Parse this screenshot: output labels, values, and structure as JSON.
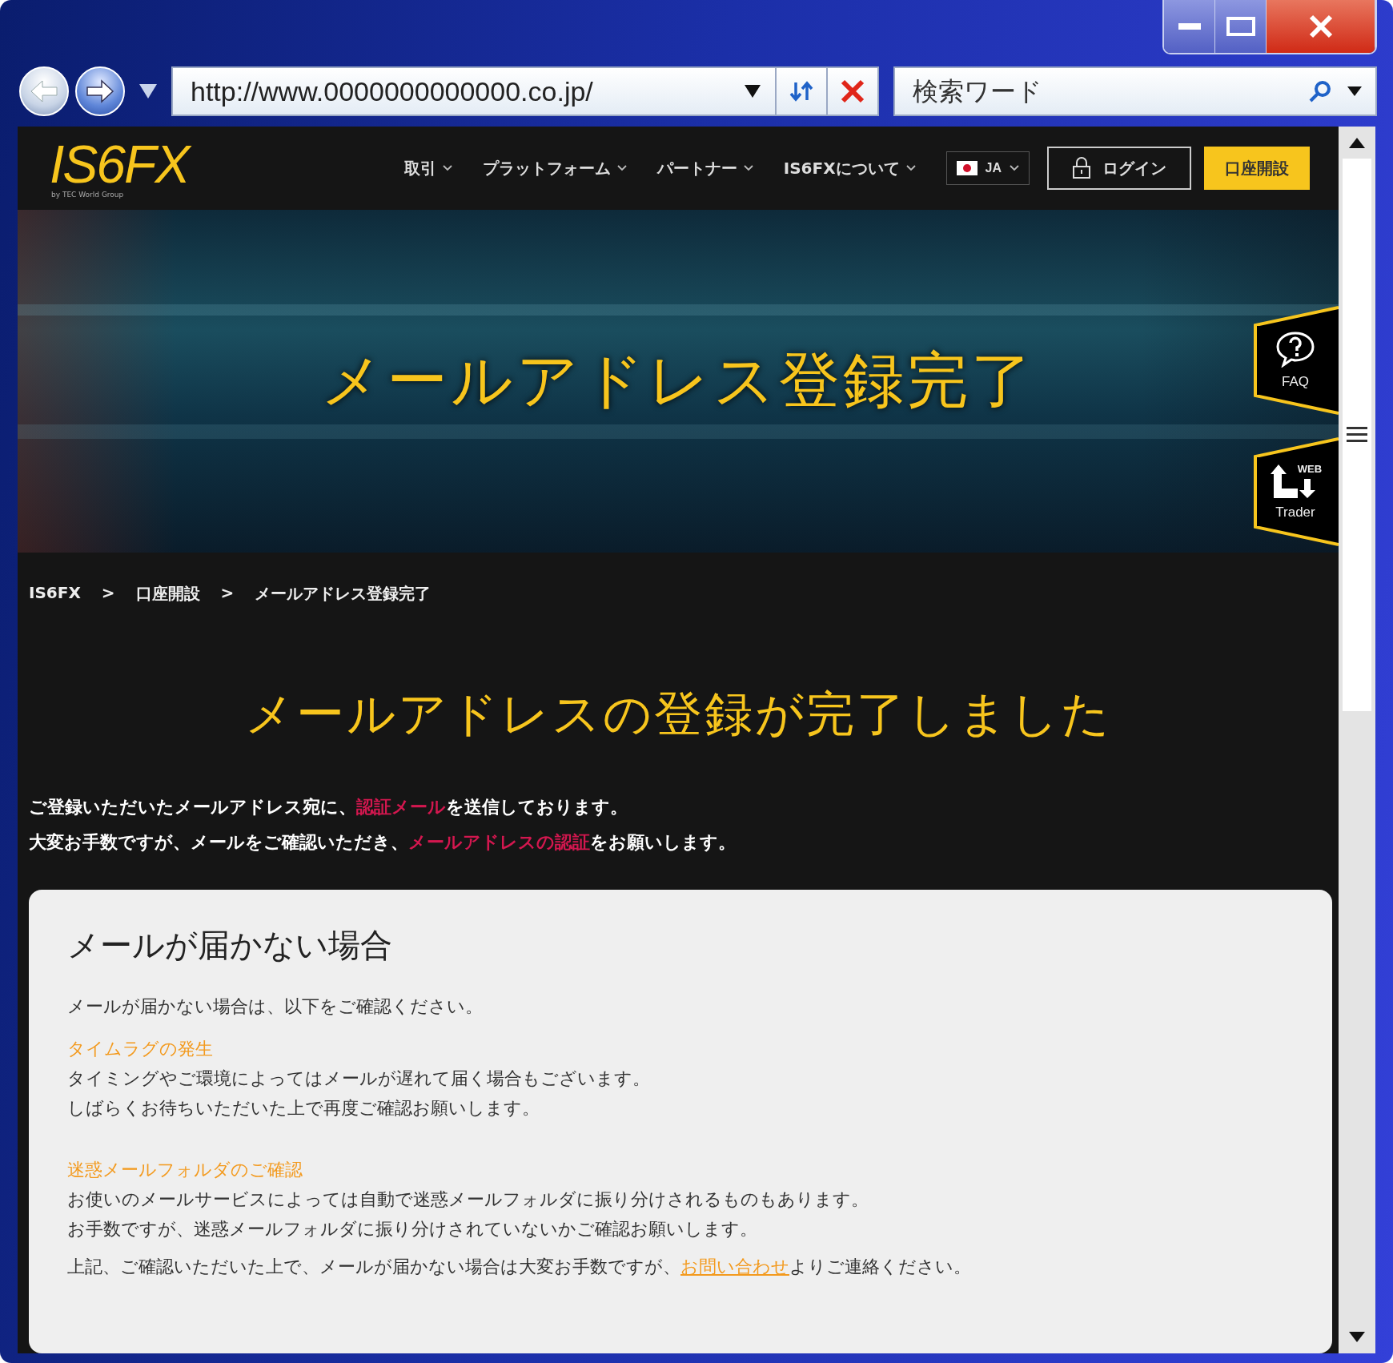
{
  "browser": {
    "url": "http://www.0000000000000.co.jp/",
    "search_placeholder": "検索ワード"
  },
  "nav": {
    "logo": "IS6FX",
    "logo_sub": "by TEC World Group",
    "items": [
      {
        "label": "取引"
      },
      {
        "label": "プラットフォーム"
      },
      {
        "label": "パートナー"
      },
      {
        "label": "IS6FXについて"
      }
    ],
    "language": "JA",
    "login": "ログイン",
    "open_account": "口座開設"
  },
  "hero": {
    "title": "メールアドレス登録完了",
    "side_tabs": [
      {
        "kind": "faq",
        "label": "FAQ"
      },
      {
        "kind": "webtrader",
        "badge": "WEB",
        "label": "Trader"
      }
    ]
  },
  "breadcrumb": [
    {
      "kind": "link",
      "label": "IS6FX"
    },
    {
      "kind": "separator",
      "label": ">"
    },
    {
      "kind": "link",
      "label": "口座開設"
    },
    {
      "kind": "separator",
      "label": ">"
    },
    {
      "kind": "current",
      "label": "メールアドレス登録完了"
    }
  ],
  "heading": "メールアドレスの登録が完了しました",
  "intro": [
    {
      "parts": [
        {
          "text": "ご登録いただいたメールアドレス宛に、",
          "link": false
        },
        {
          "text": "認証メール",
          "link": true
        },
        {
          "text": "を送信しております。",
          "link": false
        }
      ]
    },
    {
      "parts": [
        {
          "text": "大変お手数ですが、メールをご確認いただき、",
          "link": false
        },
        {
          "text": "メールアドレスの認証",
          "link": true
        },
        {
          "text": "をお願いします。",
          "link": false
        }
      ]
    }
  ],
  "card": {
    "title": "メールが届かない場合",
    "intro": "メールが届かない場合は、以下をご確認ください。",
    "sections": [
      {
        "heading": "タイムラグの発生",
        "lines": [
          "タイミングやご環境によってはメールが遅れて届く場合もございます。",
          "しばらくお待ちいただいた上で再度ご確認お願いします。"
        ]
      },
      {
        "heading": "迷惑メールフォルダのご確認",
        "lines": [
          "お使いのメールサービスによっては自動で迷惑メールフォルダに振り分けされるものもあります。",
          "お手数ですが、迷惑メールフォルダに振り分けされていないかご確認お願いします。"
        ]
      }
    ],
    "footer": [
      {
        "text": "上記、ご確認いただいた上で、メールが届かない場合は大変お手数ですが、",
        "link": false
      },
      {
        "text": "お問い合わせ",
        "link": true
      },
      {
        "text": "よりご連絡ください。",
        "link": false
      }
    ]
  }
}
